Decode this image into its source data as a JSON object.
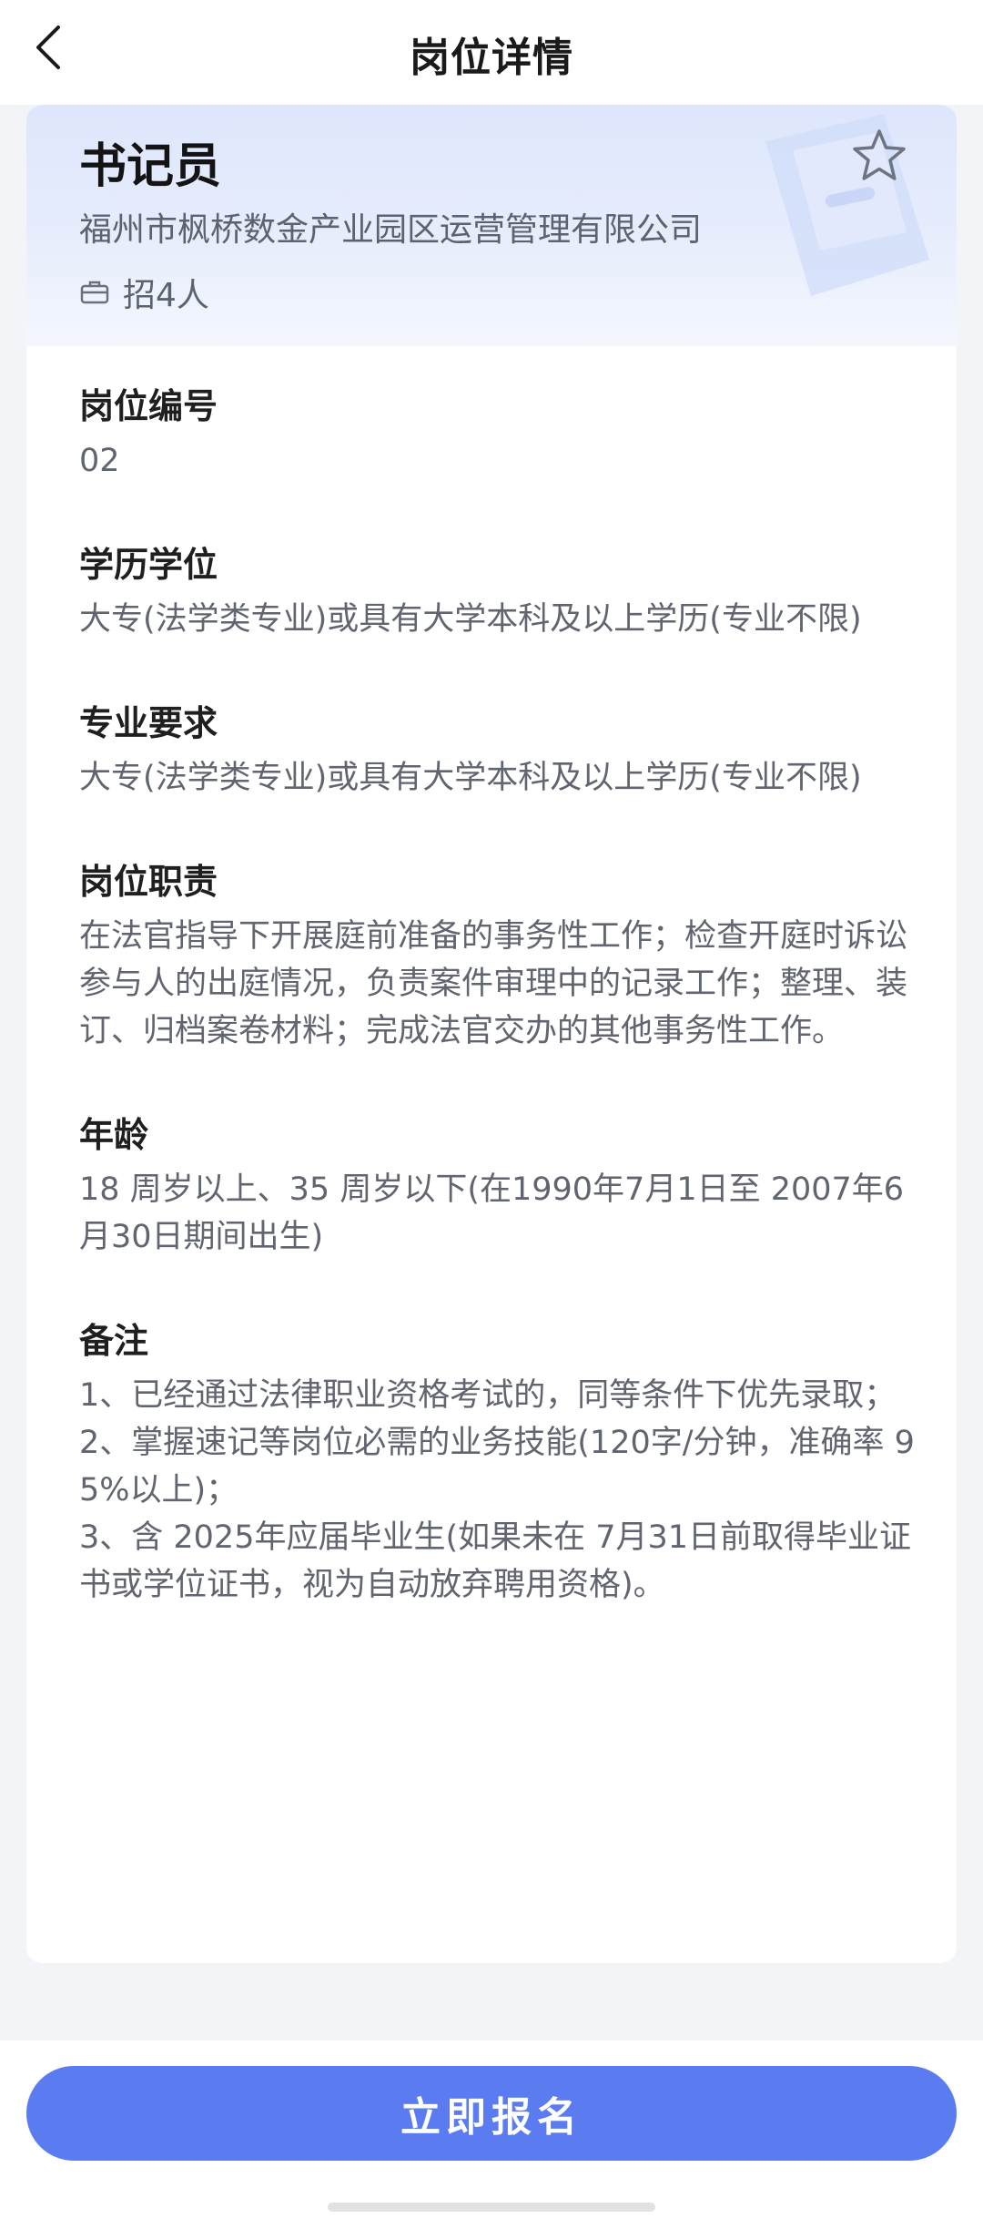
{
  "header": {
    "title": "岗位详情"
  },
  "job": {
    "title": "书记员",
    "company": "福州市枫桥数金产业园区运营管理有限公司",
    "hire_count": "招4人"
  },
  "sections": [
    {
      "label": "岗位编号",
      "value": "02"
    },
    {
      "label": "学历学位",
      "value": "大专(法学类专业)或具有大学本科及以上学历(专业不限)"
    },
    {
      "label": "专业要求",
      "value": "大专(法学类专业)或具有大学本科及以上学历(专业不限)"
    },
    {
      "label": "岗位职责",
      "value": "在法官指导下开展庭前准备的事务性工作；检查开庭时诉讼参与人的出庭情况，负责案件审理中的记录工作；整理、装订、归档案卷材料；完成法官交办的其他事务性工作。"
    },
    {
      "label": "年龄",
      "value": "18 周岁以上、35 周岁以下(在1990年7月1日至 2007年6月30日期间出生)"
    },
    {
      "label": "备注",
      "value": "1、已经通过法律职业资格考试的，同等条件下优先录取；\n2、掌握速记等岗位必需的业务技能(120字/分钟，准确率 95%以上)；\n3、含 2025年应届毕业生(如果未在 7月31日前取得毕业证书或学位证书，视为自动放弃聘用资格)。"
    }
  ],
  "actions": {
    "apply_label": "立即报名"
  },
  "icons": {
    "back": "chevron-left-icon",
    "favorite": "star-outline-icon",
    "hire": "briefcase-icon"
  },
  "colors": {
    "primary": "#5b7cf0",
    "hero_bg": "#dde6fb"
  }
}
